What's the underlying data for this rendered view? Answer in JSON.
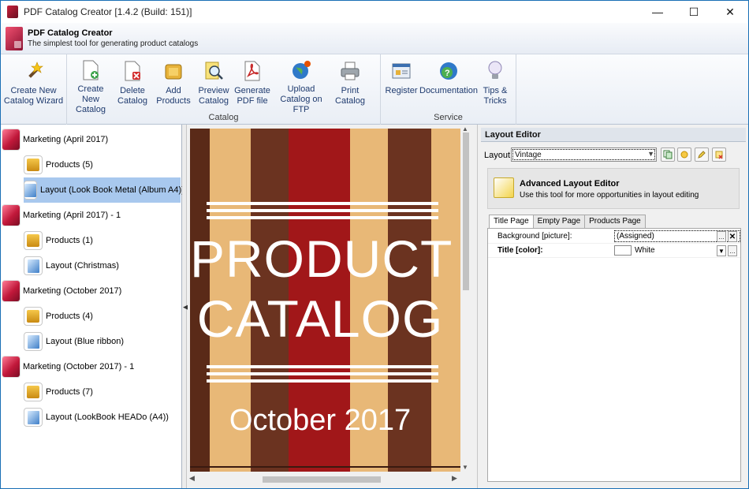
{
  "window": {
    "title": "PDF Catalog Creator [1.4.2 (Build: 151)]",
    "controls": [
      "—",
      "☐",
      "✕"
    ]
  },
  "header": {
    "app_name": "PDF Catalog Creator",
    "tagline": "The simplest tool for generating product catalogs"
  },
  "ribbon": {
    "groups": [
      {
        "label": "",
        "buttons": [
          {
            "label": "Create New\nCatalog Wizard",
            "icon": "magic-wand-icon"
          }
        ]
      },
      {
        "label": "Catalog",
        "buttons": [
          {
            "label": "Create New\nCatalog",
            "icon": "new-document-icon"
          },
          {
            "label": "Delete\nCatalog",
            "icon": "delete-document-icon"
          },
          {
            "label": "Add\nProducts",
            "icon": "products-box-icon"
          },
          {
            "label": "Preview\nCatalog",
            "icon": "preview-magnifier-icon"
          },
          {
            "label": "Generate\nPDF file",
            "icon": "pdf-icon"
          },
          {
            "label": "Upload\nCatalog on FTP",
            "icon": "globe-upload-icon"
          },
          {
            "label": "Print\nCatalog",
            "icon": "printer-icon"
          }
        ]
      },
      {
        "label": "Service",
        "buttons": [
          {
            "label": "Register",
            "icon": "register-icon"
          },
          {
            "label": "Documentation",
            "icon": "help-globe-icon"
          },
          {
            "label": "Tips &\nTricks",
            "icon": "lightbulb-icon"
          }
        ]
      }
    ]
  },
  "tree": [
    {
      "label": "Marketing (April 2017)",
      "type": "catalog"
    },
    {
      "label": "Products (5)",
      "type": "products"
    },
    {
      "label": "Layout (Look Book Metal (Album A4))",
      "type": "layout",
      "selected": true
    },
    {
      "label": "Marketing (April 2017) - 1",
      "type": "catalog"
    },
    {
      "label": "Products (1)",
      "type": "products"
    },
    {
      "label": "Layout (Christmas)",
      "type": "layout"
    },
    {
      "label": "Marketing (October 2017)",
      "type": "catalog"
    },
    {
      "label": "Products (4)",
      "type": "products"
    },
    {
      "label": "Layout (Blue ribbon)",
      "type": "layout"
    },
    {
      "label": "Marketing (October 2017) - 1",
      "type": "catalog"
    },
    {
      "label": "Products (7)",
      "type": "products"
    },
    {
      "label": "Layout (LookBook HEADo (A4))",
      "type": "layout"
    }
  ],
  "preview": {
    "title_line1": "PRODUCT",
    "title_line2": "CATALOG",
    "subtitle": "October 2017",
    "colors": {
      "dark_stripe": "#5a2a18",
      "red_stripe": "#a11719",
      "light_stripe": "#e8b877"
    }
  },
  "layout_editor": {
    "header": "Layout Editor",
    "layout_label": "Layout",
    "layout_value": "Vintage",
    "advanced_title": "Advanced Layout Editor",
    "advanced_desc": "Use this tool for more opportunities in layout editing",
    "tabs": [
      "Title Page",
      "Empty Page",
      "Products Page"
    ],
    "active_tab": "Title Page",
    "properties": [
      {
        "name": "Background [picture]:",
        "value": "(Assigned)",
        "bold": false
      },
      {
        "name": "Title [color]:",
        "value": "White",
        "bold": true
      }
    ]
  }
}
